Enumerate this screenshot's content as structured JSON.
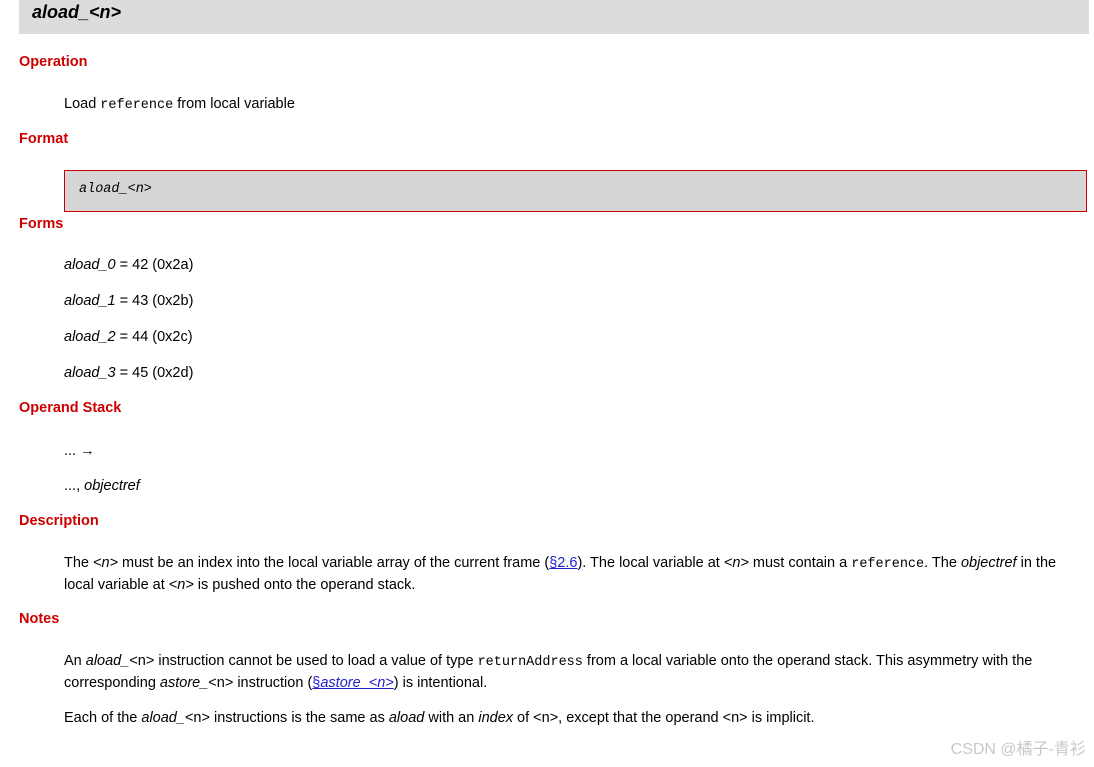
{
  "title": "aload_<n>",
  "sections": {
    "operation": "Operation",
    "format": "Format",
    "forms": "Forms",
    "operand_stack": "Operand Stack",
    "description": "Description",
    "notes": "Notes"
  },
  "operation": {
    "pre": "Load ",
    "code": "reference",
    "post": " from local variable"
  },
  "format_text": "aload_<n>",
  "forms": [
    {
      "name": "aload_0",
      "value": " = 42 (0x2a)"
    },
    {
      "name": "aload_1",
      "value": " = 43 (0x2b)"
    },
    {
      "name": "aload_2",
      "value": " = 44 (0x2c)"
    },
    {
      "name": "aload_3",
      "value": " = 45 (0x2d)"
    }
  ],
  "operand_stack": {
    "before": "... →",
    "after_prefix": "..., ",
    "after_italic": "objectref"
  },
  "description": {
    "t1": "The ",
    "n1": "<n>",
    "t2": " must be an index into the local variable array of the current frame (",
    "link": "§2.6",
    "t3": "). The local variable at ",
    "n2": "<n>",
    "t4": " must contain a ",
    "code": "reference",
    "t5": ". The ",
    "objectref": "objectref",
    "t6": " in the local variable at ",
    "n3": "<n>",
    "t7": " is pushed onto the operand stack."
  },
  "notes": {
    "p1": {
      "t1": "An ",
      "i1": "aload_",
      "n1": "<n>",
      "t2": " instruction cannot be used to load a value of type ",
      "code": "returnAddress",
      "t3": " from a local variable onto the operand stack. This asymmetry with the corresponding ",
      "i2": "astore_",
      "n2": "<n>",
      "t4": " instruction (",
      "link_prefix": "§",
      "link_text": "astore_<n>",
      "t5": ") is intentional."
    },
    "p2": {
      "t1": "Each of the ",
      "i1": "aload_",
      "n1": "<n>",
      "t2": " instructions is the same as ",
      "i2": "aload",
      "t3": " with an ",
      "i3": "index",
      "t4": " of ",
      "n2": "<n>",
      "t5": ", except that the operand ",
      "n3": "<n>",
      "t6": " is implicit."
    }
  },
  "watermark": "CSDN @橘子-青衫"
}
